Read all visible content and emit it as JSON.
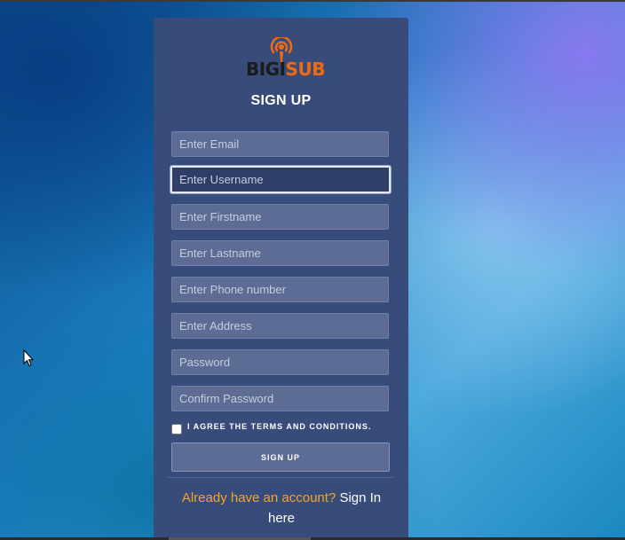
{
  "app": {
    "logo_left": "BIGI",
    "logo_right": "SUB",
    "logo_icon": "podcast-icon"
  },
  "form": {
    "title": "SIGN UP",
    "fields": [
      {
        "name": "email",
        "placeholder": "Enter Email",
        "value": ""
      },
      {
        "name": "username",
        "placeholder": "Enter Username",
        "value": "",
        "focused": true
      },
      {
        "name": "firstname",
        "placeholder": "Enter Firstname",
        "value": ""
      },
      {
        "name": "lastname",
        "placeholder": "Enter Lastname",
        "value": ""
      },
      {
        "name": "phone",
        "placeholder": "Enter Phone number",
        "value": ""
      },
      {
        "name": "address",
        "placeholder": "Enter Address",
        "value": ""
      },
      {
        "name": "password",
        "placeholder": "Password",
        "value": ""
      },
      {
        "name": "confirm_password",
        "placeholder": "Confirm Password",
        "value": ""
      }
    ],
    "agree_label": "I AGREE THE TERMS AND CONDITIONS.",
    "agree_checked": false,
    "submit_label": "SIGN UP",
    "footer_question": "Already have an account?",
    "footer_link": "Sign In here"
  },
  "colors": {
    "accent": "#f26a10",
    "card": "#374c7a",
    "question": "#f5a623"
  }
}
